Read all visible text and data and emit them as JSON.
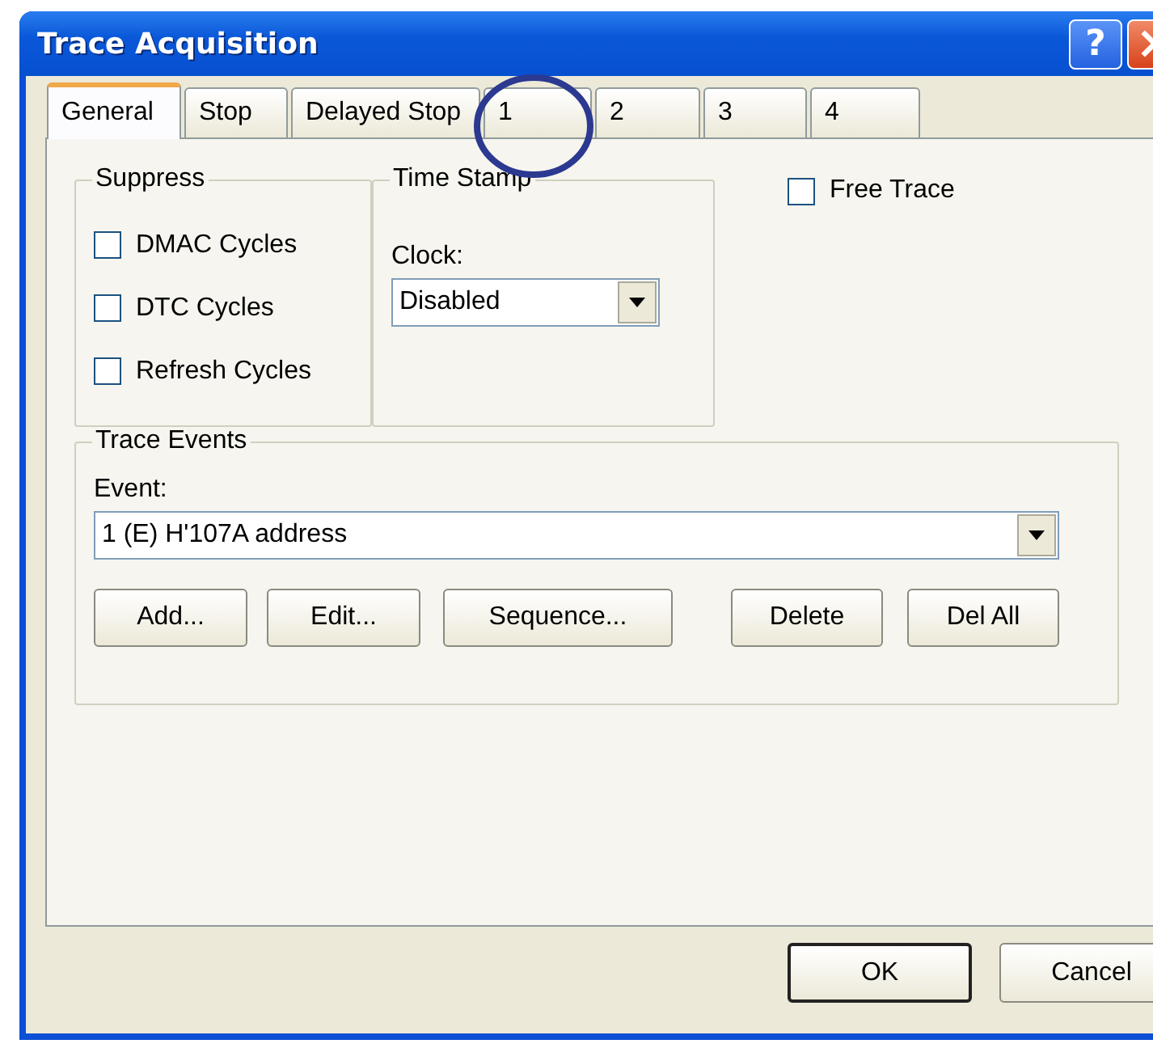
{
  "window": {
    "title": "Trace Acquisition",
    "buttons": [
      {
        "kind": "help",
        "label": "?"
      },
      {
        "kind": "close"
      }
    ]
  },
  "tabs": [
    {
      "label": "General",
      "selected": true
    },
    {
      "label": "Stop",
      "selected": false
    },
    {
      "label": "Delayed Stop",
      "selected": false
    },
    {
      "label": "1",
      "selected": false
    },
    {
      "label": "2",
      "selected": false
    },
    {
      "label": "3",
      "selected": false
    },
    {
      "label": "4",
      "selected": false
    }
  ],
  "suppress": {
    "title": "Suppress",
    "options": [
      {
        "label": "DMAC Cycles",
        "checked": false
      },
      {
        "label": "DTC Cycles",
        "checked": false
      },
      {
        "label": "Refresh Cycles",
        "checked": false
      }
    ]
  },
  "time_stamp": {
    "title": "Time Stamp",
    "label": "Clock:",
    "value": "Disabled"
  },
  "free_trace": {
    "label": "Free Trace",
    "checked": false
  },
  "trace_events": {
    "title": "Trace Events",
    "label": "Event:",
    "value": "1 (E) H'107A address",
    "buttons": [
      "Add...",
      "Edit...",
      "Sequence...",
      "Delete",
      "Del All"
    ]
  },
  "footer_buttons": [
    {
      "label": "OK",
      "default": true
    },
    {
      "label": "Cancel",
      "default": false
    }
  ]
}
